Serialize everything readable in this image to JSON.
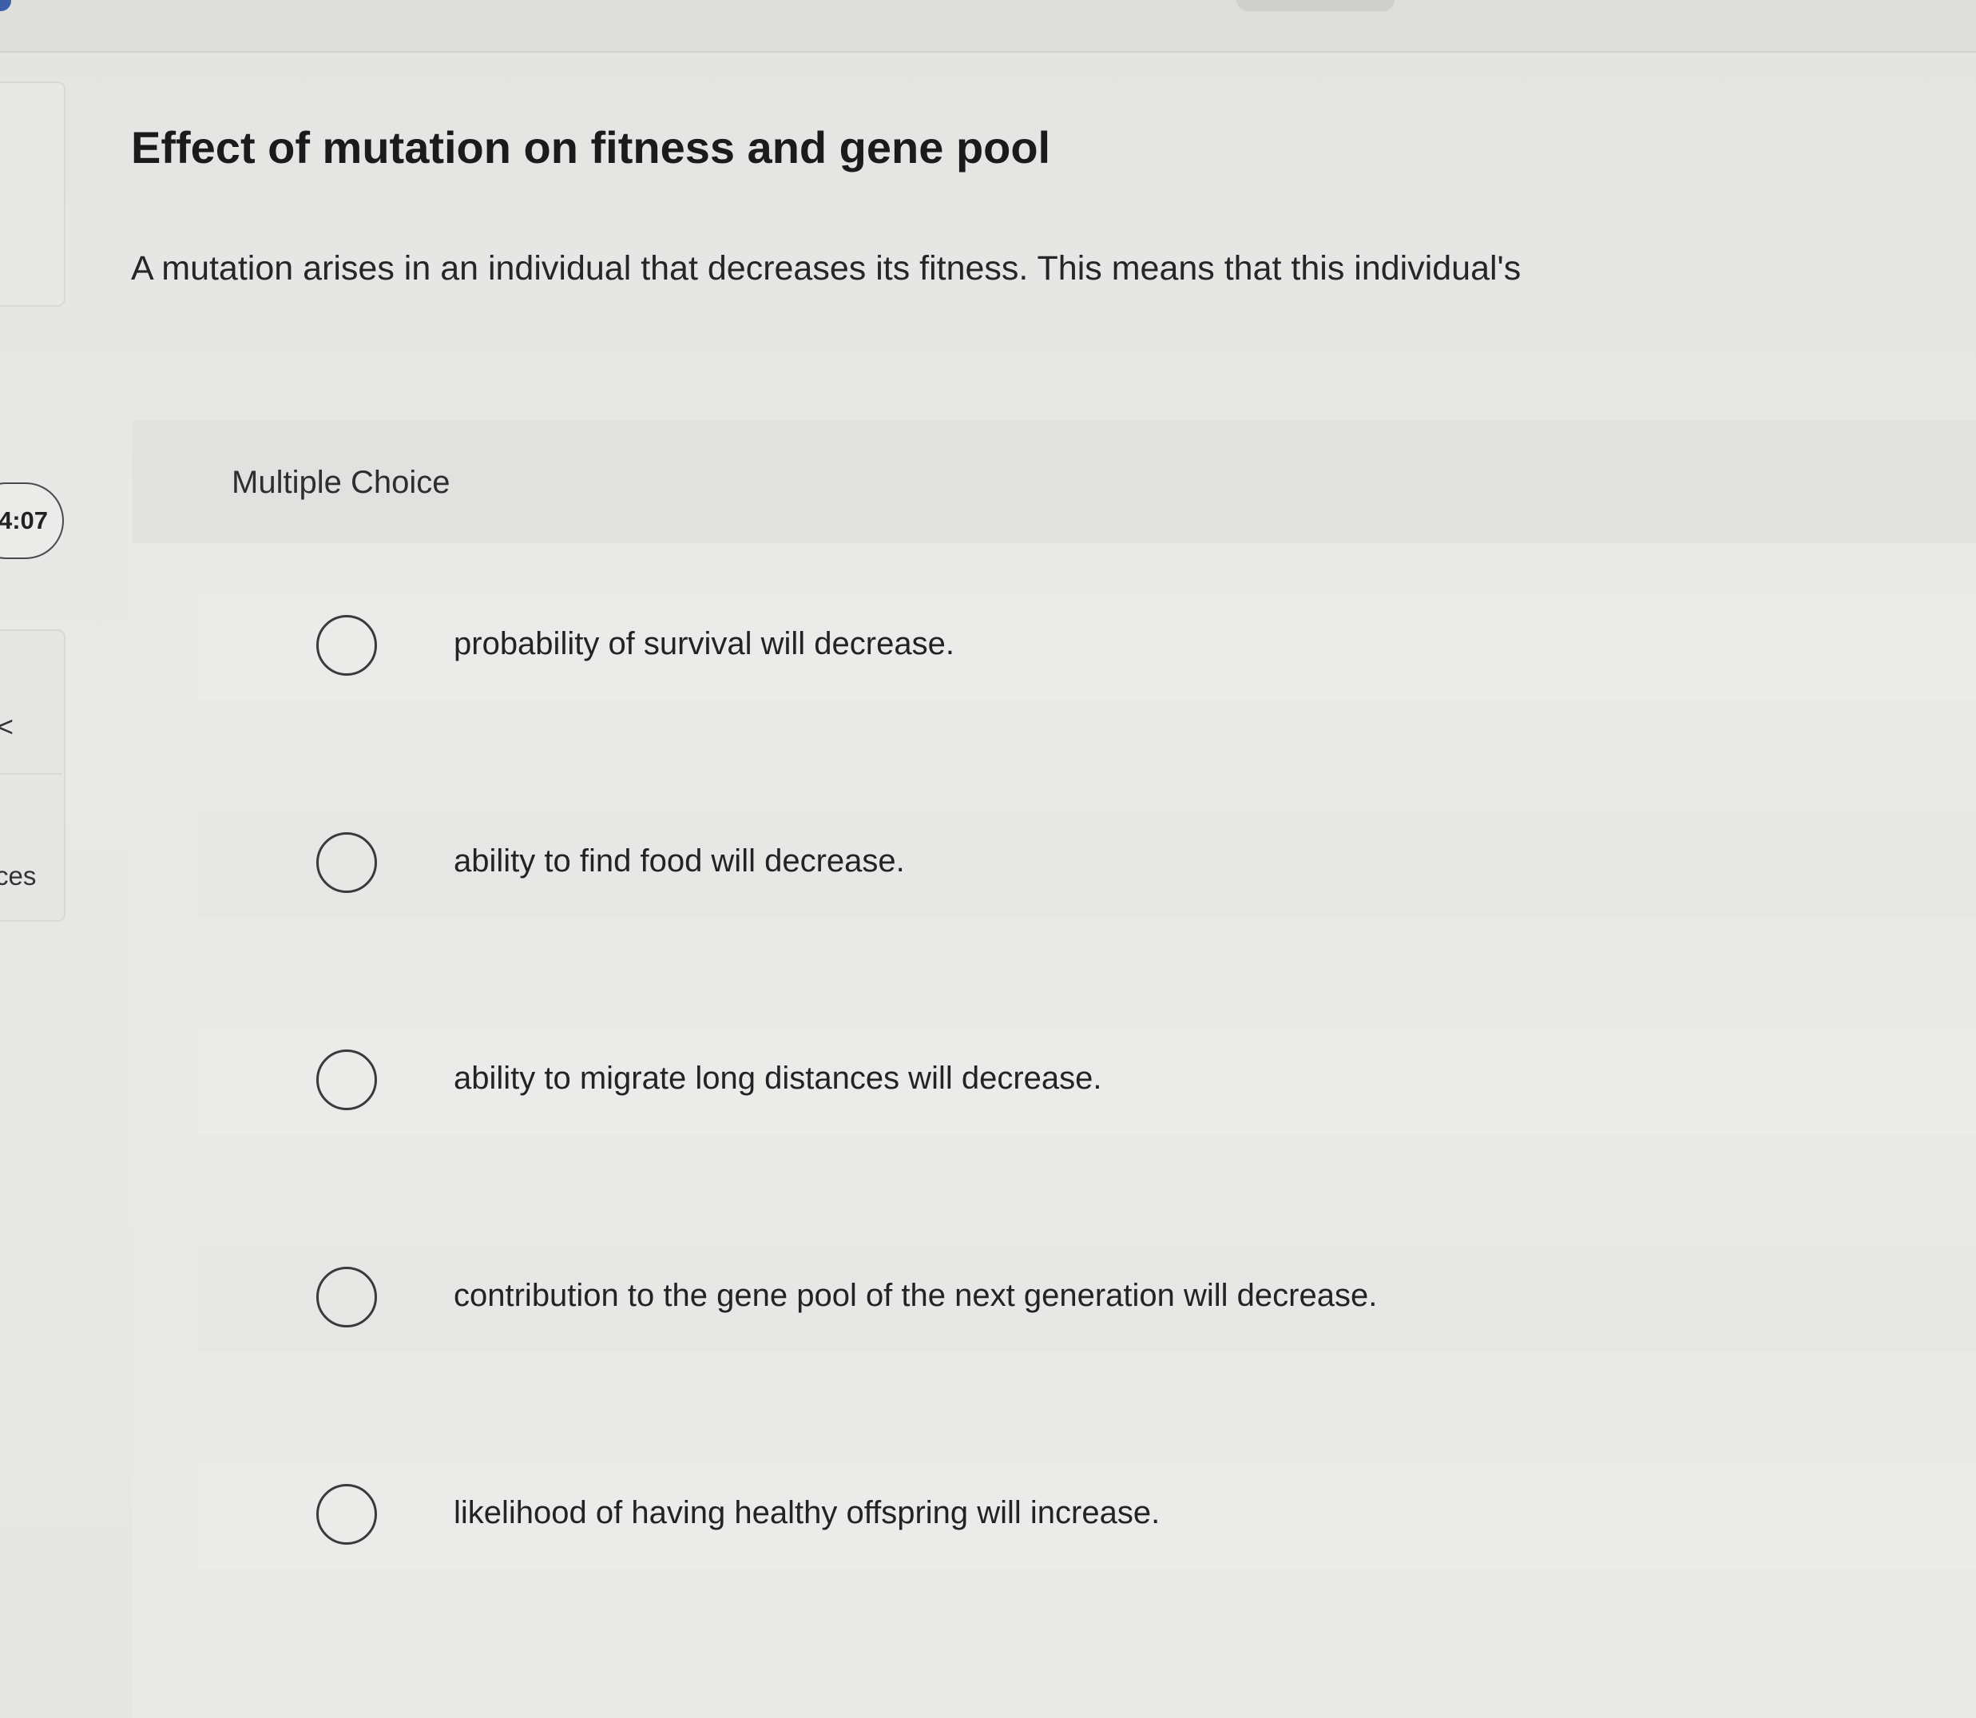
{
  "sidebar": {
    "timer": "4:07",
    "chevron_glyph": "<",
    "resources_label_fragment": "ces"
  },
  "question": {
    "title": "Effect of mutation on fitness and gene pool",
    "prompt": "A mutation arises in an individual that decreases its fitness. This means that this individual's",
    "type_label": "Multiple Choice",
    "options": [
      {
        "label": "probability of survival will decrease.",
        "selected": false
      },
      {
        "label": "ability to find food will decrease.",
        "selected": false
      },
      {
        "label": "ability to migrate long distances will decrease.",
        "selected": false
      },
      {
        "label": "contribution to the gene pool of the next generation will decrease.",
        "selected": false
      },
      {
        "label": "likelihood of having healthy offspring will increase.",
        "selected": false
      }
    ]
  },
  "colors": {
    "page_background": "#e6e6e4",
    "text": "#1e1e1e",
    "radio_border": "#3a3a3a",
    "accent_dot": "#3b5fa8"
  }
}
